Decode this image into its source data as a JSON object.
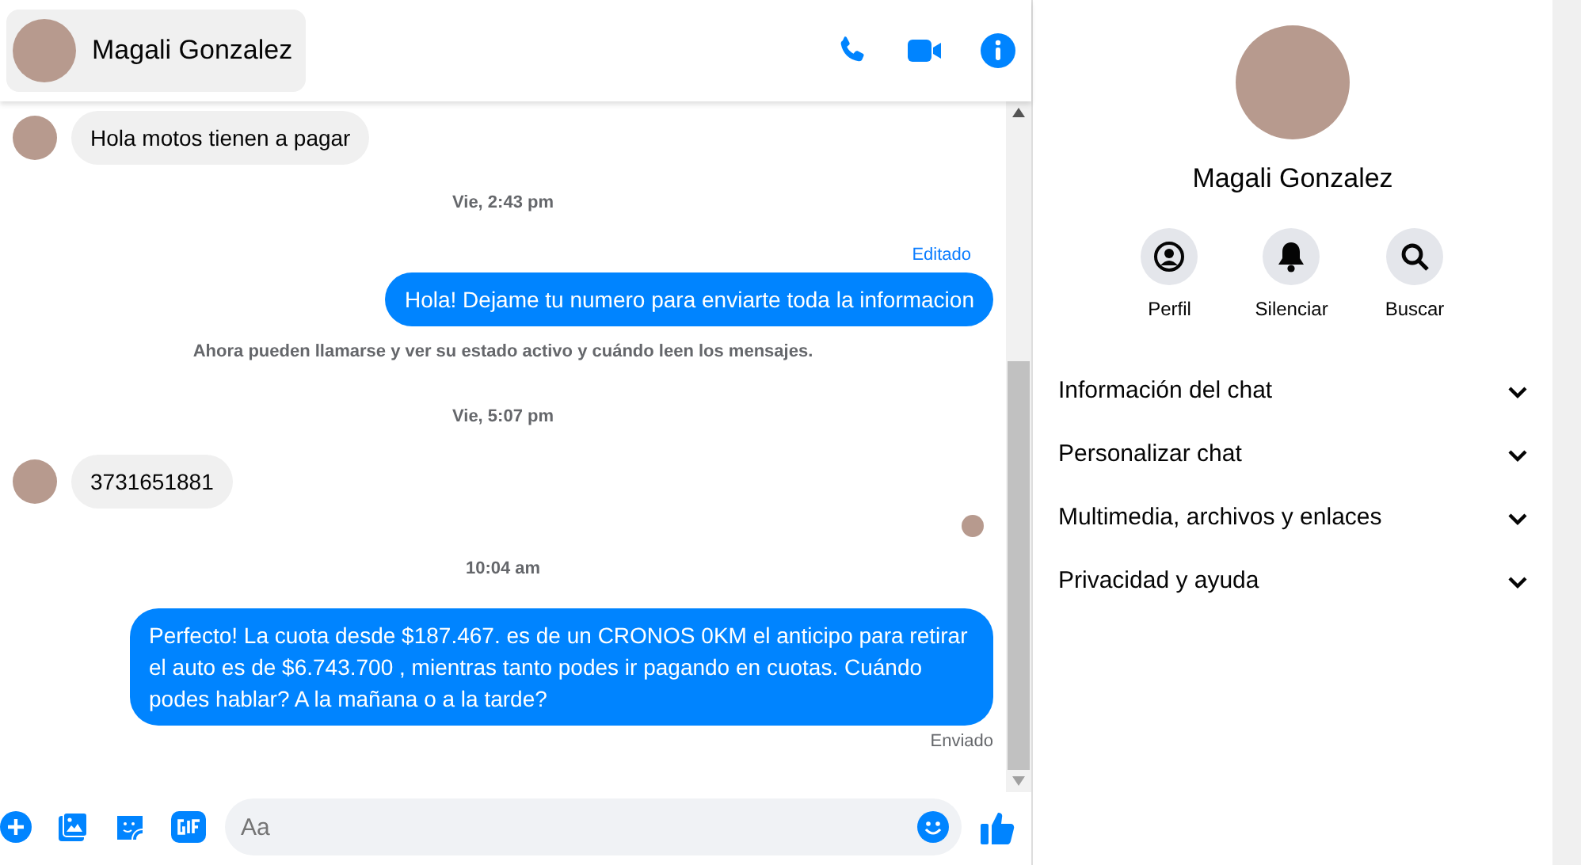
{
  "header": {
    "name": "Magali Gonzalez"
  },
  "messages": [
    {
      "kind": "incoming",
      "text": "Hola motos tienen a pagar"
    },
    {
      "kind": "timestamp",
      "text": "Vie, 2:43 pm"
    },
    {
      "kind": "outgoing",
      "text": "Hola! Dejame tu numero  para enviarte toda la informacion",
      "label": "Editado"
    },
    {
      "kind": "notice",
      "text": "Ahora pueden llamarse y ver su estado activo y cuándo leen los mensajes."
    },
    {
      "kind": "timestamp",
      "text": "Vie, 5:07 pm"
    },
    {
      "kind": "incoming",
      "text": "3731651881"
    },
    {
      "kind": "seen"
    },
    {
      "kind": "timestamp",
      "text": "10:04 am"
    },
    {
      "kind": "outgoing",
      "text": "Perfecto! La cuota desde $187.467. es de un CRONOS 0KM el anticipo para retirar el auto es de $6.743.700 , mientras tanto podes ir pagando en cuotas. Cuándo podes hablar? A la mañana o a la tarde?",
      "status": "Enviado"
    }
  ],
  "composer": {
    "placeholder": "Aa"
  },
  "profile": {
    "name": "Magali Gonzalez",
    "actions": [
      {
        "kind": "profile",
        "label": "Perfil"
      },
      {
        "kind": "mute",
        "label": "Silenciar"
      },
      {
        "kind": "search",
        "label": "Buscar"
      }
    ],
    "sections": [
      {
        "label": "Información del chat",
        "expanded": false
      },
      {
        "label": "Personalizar chat",
        "expanded": false
      },
      {
        "label": "Multimedia, archivos y enlaces",
        "expanded": false
      },
      {
        "label": "Privacidad y ayuda",
        "expanded": false
      }
    ]
  }
}
